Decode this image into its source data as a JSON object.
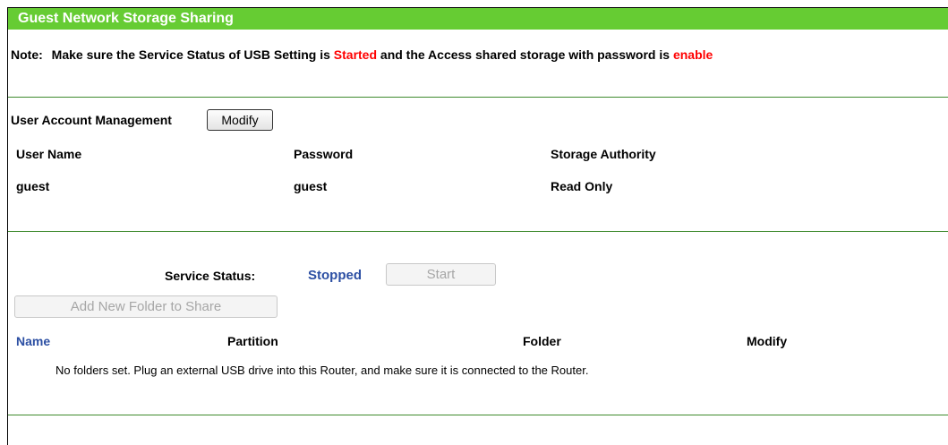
{
  "header": {
    "title": "Guest Network Storage Sharing"
  },
  "note": {
    "label": "Note:",
    "part1": "Make sure the Service Status of USB Setting is",
    "started": "Started",
    "part2": "and the Access shared storage with password is",
    "enable": "enable"
  },
  "account": {
    "label": "User Account Management",
    "modify_button": "Modify",
    "columns": [
      "User Name",
      "Password",
      "Storage Authority"
    ],
    "row": [
      "guest",
      "guest",
      "Read Only"
    ]
  },
  "service": {
    "label": "Service Status:",
    "status": "Stopped",
    "start_button": "Start",
    "add_folder_button": "Add New Folder to Share"
  },
  "folders": {
    "columns": [
      "Name",
      "Partition",
      "Folder",
      "Modify"
    ],
    "empty_message": "No folders set. Plug an external USB drive into this Router, and make sure it is connected to the Router."
  },
  "colors": {
    "header_bg": "#66cc33",
    "accent_red": "#ff0000",
    "status_blue": "#2c4fa3",
    "divider_green": "#3e8a2d"
  }
}
